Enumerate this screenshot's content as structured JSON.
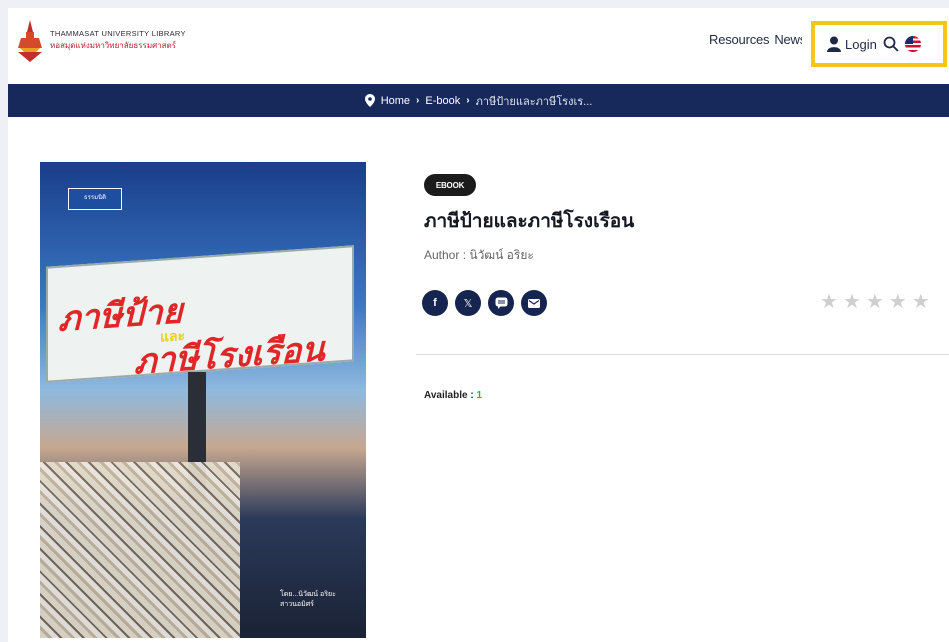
{
  "header": {
    "logo_en": "THAMMASAT UNIVERSITY LIBRARY",
    "logo_th": "หอสมุดแห่งมหาวิทยาลัยธรรมศาสตร์",
    "nav": {
      "resources": "Resources",
      "news": "News"
    },
    "login_label": "Login",
    "icons": {
      "user": "user-icon",
      "search": "search-icon",
      "language": "us-flag-icon"
    }
  },
  "breadcrumb": {
    "items": [
      "Home",
      "E-book",
      "ภาษีป้ายและภาษีโรงเร..."
    ],
    "icon": "location-pin-icon"
  },
  "book": {
    "badge": "EBOOK",
    "title": "ภาษีป้ายและภาษีโรงเรือน",
    "author_label": "Author : ",
    "author": "นิวัฒน์ อริยะ",
    "available_label": "Available : ",
    "available_value": "1",
    "rating_stars": 0,
    "rating_max": 5,
    "cover": {
      "publisher": "ธรรมนิติ",
      "line1": "ภาษีป้าย",
      "mid": "และ",
      "line2": "ภาษีโรงเรือน",
      "credit1": "โดย...นิวัฒน์ อริยะ",
      "credit2": "สาวนอมิศร์"
    }
  },
  "share": {
    "facebook": "f",
    "x": "𝕏",
    "line": "line-icon",
    "email": "mail-icon"
  },
  "colors": {
    "navy": "#17295a",
    "highlight": "#f5c518",
    "logo_red": "#b8202e",
    "available_green": "#2bb24c"
  }
}
